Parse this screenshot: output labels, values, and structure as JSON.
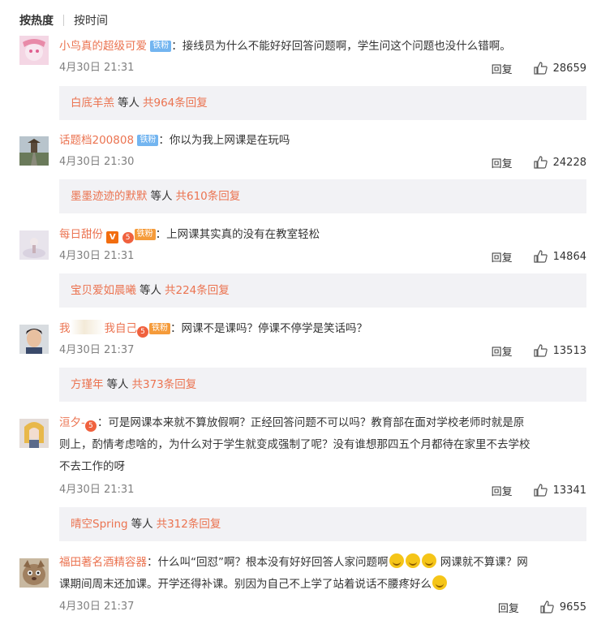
{
  "tabs": {
    "hot": "按热度",
    "time": "按时间"
  },
  "labels": {
    "reply": "回复"
  },
  "comments": [
    {
      "user": "小鸟真的超级可爱",
      "badge": "铁粉",
      "colon": "：",
      "text": "接线员为什么不能好好回答问题啊，学生问这个问题也没什么错啊。",
      "time": "4月30日 21:31",
      "likes": "28659",
      "replies": {
        "user": "白底羊羔",
        "etc": "等人",
        "count": "共964条回复"
      }
    },
    {
      "user": "话题档200808",
      "badge": "铁粉",
      "colon": "：",
      "text": "你以为我上网课是在玩吗",
      "time": "4月30日 21:30",
      "likes": "24228",
      "replies": {
        "user": "墨墨迹迹的默默",
        "etc": "等人",
        "count": "共610条回复"
      }
    },
    {
      "user": "每日甜份",
      "badge": "铁粉",
      "vip": "V",
      "fan": "5",
      "colon": "：",
      "text": "上网课其实真的没有在教室轻松",
      "time": "4月30日 21:31",
      "likes": "14864",
      "replies": {
        "user": "宝贝爱如晨曦",
        "etc": "等人",
        "count": "共224条回复"
      }
    },
    {
      "user_a": "我",
      "user_b": "我自己",
      "badge": "铁粉",
      "fan": "5",
      "colon": "：",
      "text": "网课不是课吗？停课不停学是笑话吗？",
      "time": "4月30日 21:37",
      "likes": "13513",
      "replies": {
        "user": "方瑾年",
        "etc": "等人",
        "count": "共373条回复"
      }
    },
    {
      "user": "洹夕-",
      "fan": "5",
      "colon": "：",
      "line1": "可是网课本来就不算放假啊？正经回答问题不可以吗？教育部在面对学校老师时就是原",
      "line2": "则上，酌情考虑啥的，为什么对于学生就变成强制了呢？没有谁想那四五个月都待在家里不去学校",
      "line3": "不去工作的呀",
      "time": "4月30日 21:31",
      "likes": "13341",
      "replies": {
        "user": "晴空Spring",
        "etc": "等人",
        "count": "共312条回复"
      }
    },
    {
      "user": "福田著名酒精容器",
      "colon": "：",
      "line1": "什么叫“回怼”啊？根本没有好好回答人家问题啊",
      "line1b": "网课就不算课？网",
      "line2": "课期间周末还加课。开学还得补课。别因为自己不上学了站着说话不腰疼好么",
      "time": "4月30日 21:37",
      "likes": "9655"
    }
  ],
  "colors": {
    "username": "#eb7350",
    "badge_blue": "#73b5f0",
    "reply_bg": "#f2f2f5",
    "meta": "#808080"
  }
}
